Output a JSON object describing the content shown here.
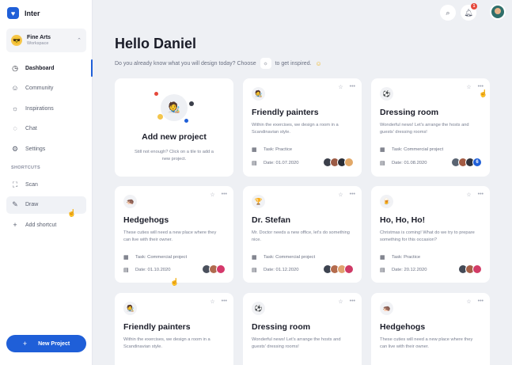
{
  "brand": {
    "name": "Inter",
    "logo_glyph": "♥"
  },
  "workspace": {
    "title": "Fine Arts",
    "subtitle": "Workspace",
    "avatar_emoji": "😎"
  },
  "nav": [
    {
      "label": "Dashboard",
      "icon": "clock-icon",
      "glyph": "◷"
    },
    {
      "label": "Community",
      "icon": "smile-icon",
      "glyph": "☺"
    },
    {
      "label": "Inspirations",
      "icon": "bulb-icon",
      "glyph": "☼"
    },
    {
      "label": "Chat",
      "icon": "chat-icon",
      "glyph": "◌"
    },
    {
      "label": "Settings",
      "icon": "gear-icon",
      "glyph": "⚙"
    }
  ],
  "shortcuts_heading": "SHORTCUTS",
  "shortcuts": [
    {
      "label": "Scan",
      "icon": "scan-icon",
      "glyph": "⛶"
    },
    {
      "label": "Draw",
      "icon": "pen-icon",
      "glyph": "✎"
    },
    {
      "label": "Add shortcut",
      "icon": "plus-icon",
      "glyph": "+"
    }
  ],
  "new_project_button": {
    "label": "New Project",
    "glyph": "+"
  },
  "topbar": {
    "search_glyph": "⌕",
    "bell_glyph": "♫",
    "notification_count": "1"
  },
  "greeting": "Hello Daniel",
  "subheading": {
    "before": "Do you already know what you will design today? Choose",
    "after": "to get inspired.",
    "chip_glyph": "☼",
    "emoji": "☺"
  },
  "add_project": {
    "title": "Add new project",
    "description": "Still not enough? Click on a tile to add a new project.",
    "emoji": "🧑‍🎨"
  },
  "cards": [
    {
      "title": "Friendly painters",
      "description": "Within the exercises, we design a room in a Scandinavian style.",
      "task": "Task: Practice",
      "date": "Date: 01.07.2020",
      "emoji": "🧑‍🎨",
      "avatar_colors": [
        "#3b3f4a",
        "#9b5a44",
        "#2a2d36",
        "#e2a868"
      ],
      "extra_count": ""
    },
    {
      "title": "Dressing room",
      "description": "Wonderful news! Let's arrange the hosts and guests' dressing rooms!",
      "task": "Task: Commercial project",
      "date": "Date: 01.08.2020",
      "emoji": "⚽",
      "avatar_colors": [
        "#5a6472",
        "#a35b43",
        "#30343e"
      ],
      "extra_count": "6"
    },
    {
      "title": "Hedgehogs",
      "description": "These cuties will need a new place where they can live with their owner.",
      "task": "Task: Commercial project",
      "date": "Date: 01.10.2020",
      "emoji": "🦔",
      "avatar_colors": [
        "#4a505c",
        "#b06a4e",
        "#d5386b"
      ],
      "extra_count": ""
    },
    {
      "title": "Dr. Stefan",
      "description": "Mr. Doctor needs a new office, let's do something nice.",
      "task": "Task: Commercial project",
      "date": "Date: 01.12.2020",
      "emoji": "🏆",
      "avatar_colors": [
        "#3d4350",
        "#b46b4d",
        "#e0a26e",
        "#cf3a66"
      ],
      "extra_count": ""
    },
    {
      "title": "Ho, Ho, Ho!",
      "description": "Christmas is coming! What do we try to prepare something for this occasion?",
      "task": "Task: Practice",
      "date": "Date: 20.12.2020",
      "emoji": "🍺",
      "avatar_colors": [
        "#444a56",
        "#a55f47",
        "#d23c66"
      ],
      "extra_count": ""
    },
    {
      "title": "Friendly painters",
      "description": "Within the exercises, we design a room in a Scandinavian style.",
      "task": "",
      "date": "",
      "emoji": "🧑‍🎨",
      "avatar_colors": [],
      "extra_count": ""
    },
    {
      "title": "Dressing room",
      "description": "Wonderful news! Let's arrange the hosts and guests' dressing rooms!",
      "task": "",
      "date": "",
      "emoji": "⚽",
      "avatar_colors": [],
      "extra_count": ""
    },
    {
      "title": "Hedgehogs",
      "description": "These cuties will need a new place where they can live with their owner.",
      "task": "",
      "date": "",
      "emoji": "🦔",
      "avatar_colors": [],
      "extra_count": ""
    }
  ],
  "colors": {
    "accent": "#1f5fd8",
    "background": "#eef0f4",
    "card": "#ffffff",
    "badge": "#e5483b"
  }
}
